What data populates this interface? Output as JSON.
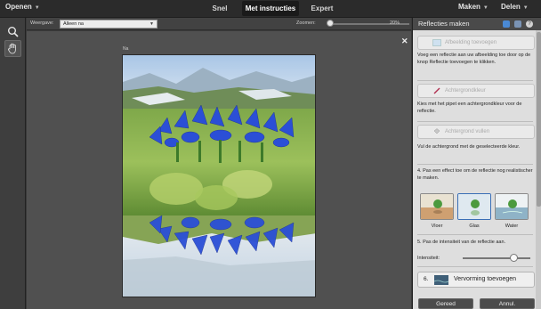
{
  "menubar": {
    "open_label": "Openen",
    "modes": [
      "Snel",
      "Met instructies",
      "Expert"
    ],
    "active_mode": "Met instructies",
    "create_label": "Maken",
    "share_label": "Delen"
  },
  "toolbox": {
    "tools": [
      {
        "icon": "zoom-icon",
        "selected": false
      },
      {
        "icon": "hand-icon",
        "selected": true
      }
    ]
  },
  "options": {
    "view_label": "Weergave:",
    "view_value": "Alleen na",
    "zoom_label": "Zoomen:",
    "zoom_value": "20%"
  },
  "canvas": {
    "doc_tab": "Na",
    "close_symbol": "✕"
  },
  "panel": {
    "title": "Reflecties maken",
    "steps": {
      "step1_button": "Afbeelding toevoegen",
      "step1_desc": "Voeg een reflectie aan uw afbeelding toe door op de knop Reflectie toevoegen te klikken.",
      "step2_button": "Achtergrondkleur",
      "step2_desc": "Kies met het pipet een achtergrondkleur voor de reflectie.",
      "step3_button": "Achtergrond vullen",
      "step3_desc": "Vul de achtergrond met de geselecteerde kleur.",
      "step4_desc": "4. Pas een effect toe om de reflectie nog realistischer te maken.",
      "effects": [
        "Vloer",
        "Glas",
        "Water"
      ],
      "step5_desc": "5. Pas de intensiteit van de reflectie aan.",
      "intensity_label": "Intensiteit:",
      "intensity_level": 0.75,
      "step6_num": "6.",
      "step6_button": "Vervorming toevoegen"
    },
    "done_label": "Gereed",
    "cancel_label": "Annul."
  },
  "colors": {
    "flower": "#2b4fd6",
    "sky": "#bcd6ee",
    "grass": "#6f9a3c",
    "panel_bg": "#dedede"
  }
}
